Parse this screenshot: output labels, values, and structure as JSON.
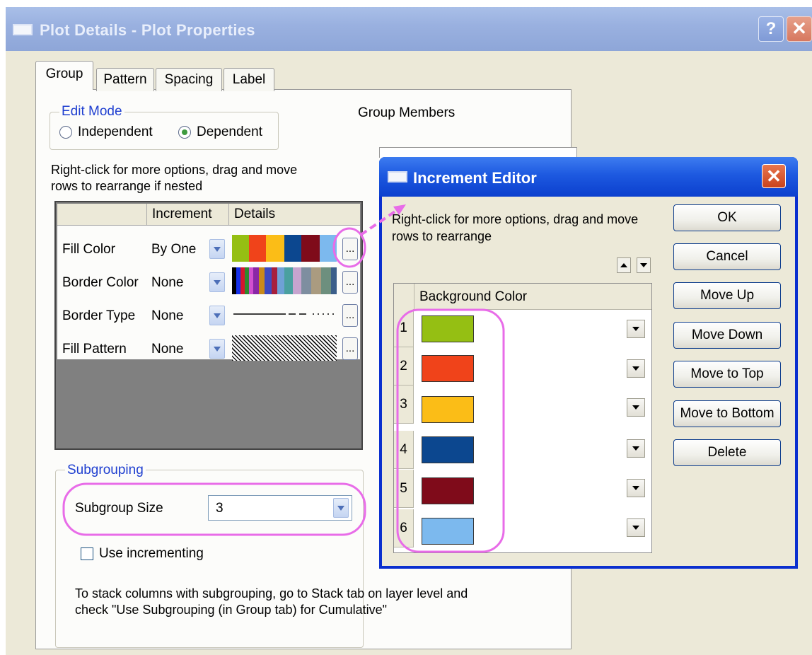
{
  "main_window": {
    "title": "Plot Details - Plot Properties",
    "help_label": "?",
    "close_label": "✕",
    "tabs": [
      "Group",
      "Pattern",
      "Spacing",
      "Label"
    ],
    "edit_mode": {
      "legend": "Edit Mode",
      "options": [
        "Independent",
        "Dependent"
      ],
      "selected": "Dependent"
    },
    "group_members_label": "Group Members",
    "hint": [
      "Right-click for more options, drag and move",
      "rows to  rearrange if nested"
    ],
    "grid": {
      "headers": [
        "Increment",
        "Details"
      ],
      "rows": [
        {
          "name": "Fill Color",
          "increment": "By One"
        },
        {
          "name": "Border Color",
          "increment": "None"
        },
        {
          "name": "Border Type",
          "increment": "None"
        },
        {
          "name": "Fill Pattern",
          "increment": "None"
        }
      ],
      "ellipsis": "..."
    },
    "subgrouping": {
      "legend": "Subgrouping",
      "size_label": "Subgroup Size",
      "size_value": "3",
      "use_incrementing_label": "Use incrementing",
      "note": [
        "To stack columns with subgrouping, go to Stack tab on layer level and",
        "check \"Use Subgrouping (in Group tab) for Cumulative\""
      ]
    }
  },
  "increment_editor": {
    "title": "Increment Editor",
    "close_label": "✕",
    "hint": [
      "Right-click for more options, drag and move",
      "rows to  rearrange"
    ],
    "column_header": "Background Color",
    "rows": [
      {
        "num": "1",
        "color": "#95bf13"
      },
      {
        "num": "2",
        "color": "#f0431a"
      },
      {
        "num": "3",
        "color": "#fbbd17"
      },
      {
        "num": "4",
        "color": "#0c478f"
      },
      {
        "num": "5",
        "color": "#7f0b1a"
      },
      {
        "num": "6",
        "color": "#7cb9ee"
      }
    ],
    "buttons": [
      "OK",
      "Cancel",
      "Move Up",
      "Move Down",
      "Move to Top",
      "Move to Bottom",
      "Delete"
    ]
  },
  "colors": {
    "highlight": "#e86ce8",
    "fill_strip": [
      "#95bf13",
      "#f0431a",
      "#fbbd17",
      "#0c478f",
      "#7f0b1a",
      "#7cb9ee"
    ]
  }
}
